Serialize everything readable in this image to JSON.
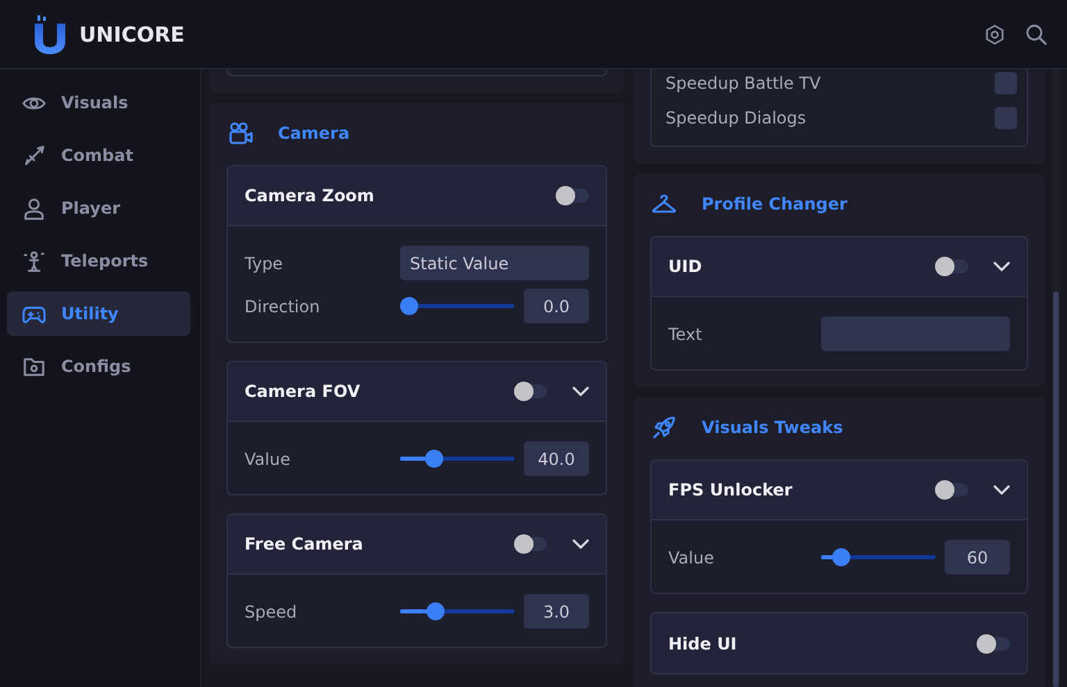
{
  "app": {
    "title": "UNICORE"
  },
  "sidebar": {
    "items": [
      {
        "label": "Visuals",
        "selected": false
      },
      {
        "label": "Combat",
        "selected": false
      },
      {
        "label": "Player",
        "selected": false
      },
      {
        "label": "Teleports",
        "selected": false
      },
      {
        "label": "Utility",
        "selected": true
      },
      {
        "label": "Configs",
        "selected": false
      }
    ]
  },
  "columns": [
    {
      "sections": [
        {
          "kind": "stub"
        },
        {
          "kind": "section",
          "title": "Camera",
          "cards": [
            {
              "kind": "feature",
              "title": "Camera Zoom",
              "on": false,
              "rows": [
                {
                  "kind": "select",
                  "label": "Type",
                  "value": "Static Value"
                },
                {
                  "kind": "slider",
                  "label": "Direction",
                  "level": 0,
                  "value": "0.0"
                }
              ]
            },
            {
              "kind": "feature",
              "title": "Camera FOV",
              "on": false,
              "expandable": true,
              "rows": [
                {
                  "kind": "slider",
                  "label": "Value",
                  "level": 0.25,
                  "value": "40.0"
                }
              ]
            },
            {
              "kind": "feature",
              "title": "Free Camera",
              "on": false,
              "expandable": true,
              "rows": [
                {
                  "kind": "slider",
                  "label": "Speed",
                  "level": 0.27,
                  "value": "3.0"
                }
              ]
            }
          ]
        }
      ]
    },
    {
      "sections": [
        {
          "kind": "partial",
          "cards": [
            {
              "kind": "list",
              "rows": [
                {
                  "kind": "checkbox",
                  "label": "Speedup Battle TV",
                  "checked": false
                },
                {
                  "kind": "checkbox",
                  "label": "Speedup Dialogs",
                  "checked": false
                }
              ]
            }
          ]
        },
        {
          "kind": "section",
          "title": "Profile Changer",
          "cards": [
            {
              "kind": "feature",
              "title": "UID",
              "on": false,
              "expandable": true,
              "rows": [
                {
                  "kind": "text",
                  "label": "Text"
                }
              ]
            }
          ]
        },
        {
          "kind": "section",
          "title": "Visuals Tweaks",
          "cards": [
            {
              "kind": "feature",
              "title": "FPS Unlocker",
              "on": false,
              "expandable": true,
              "rows": [
                {
                  "kind": "slider",
                  "label": "Value",
                  "level": 0.12,
                  "value": "60"
                }
              ]
            },
            {
              "kind": "feature",
              "title": "Hide UI",
              "on": false
            }
          ]
        }
      ]
    }
  ]
}
